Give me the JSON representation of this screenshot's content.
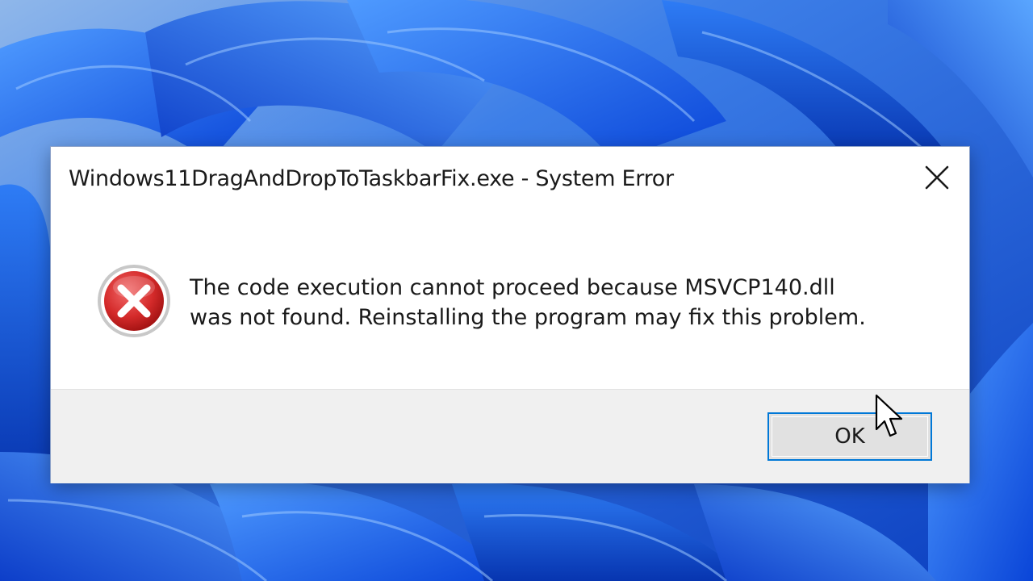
{
  "dialog": {
    "title": "Windows11DragAndDropToTaskbarFix.exe - System Error",
    "message_line1": "The code execution cannot proceed because MSVCP140.dll",
    "message_line2": "was not found. Reinstalling the program may fix this problem.",
    "ok_label": "OK",
    "icon": "error-icon",
    "close_icon": "close-icon"
  },
  "colors": {
    "wallpaper_blue": "#1a5fe0",
    "error_red": "#d42a2a",
    "button_focus_border": "#0078d7",
    "footer_bg": "#f0f0f0"
  }
}
